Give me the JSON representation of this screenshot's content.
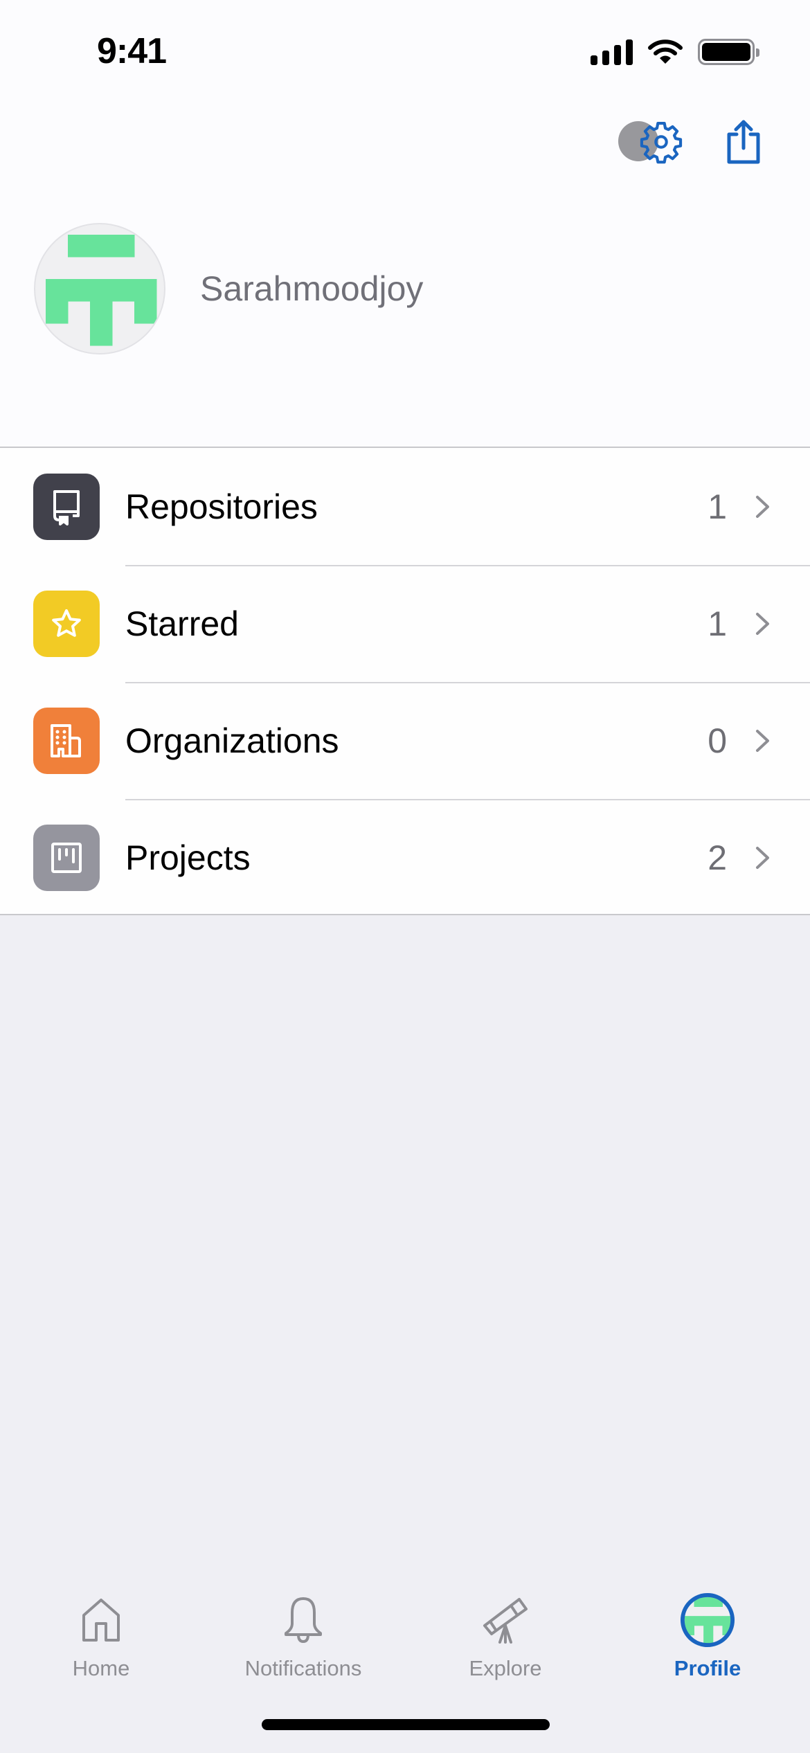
{
  "status_bar": {
    "time": "9:41",
    "icons": [
      "cellular-signal-icon",
      "wifi-icon",
      "battery-icon"
    ]
  },
  "header": {
    "actions": [
      {
        "name": "settings",
        "icon": "gear-icon"
      },
      {
        "name": "share",
        "icon": "share-icon"
      }
    ],
    "accent_color": "#1a65c0"
  },
  "profile": {
    "username": "Sarahmoodjoy",
    "avatar": {
      "type": "identicon",
      "color": "#67e39b",
      "background": "#f0f0f2",
      "grid": [
        [
          0,
          1,
          1,
          1,
          0
        ],
        [
          0,
          0,
          0,
          0,
          0
        ],
        [
          1,
          1,
          1,
          1,
          1
        ],
        [
          1,
          0,
          1,
          0,
          1
        ],
        [
          0,
          0,
          1,
          0,
          0
        ]
      ]
    }
  },
  "menu": {
    "items": [
      {
        "label": "Repositories",
        "count": "1",
        "icon": "repo-icon",
        "color": "#41414b"
      },
      {
        "label": "Starred",
        "count": "1",
        "icon": "star-icon",
        "color": "#f2cb25"
      },
      {
        "label": "Organizations",
        "count": "0",
        "icon": "organization-icon",
        "color": "#f0803a"
      },
      {
        "label": "Projects",
        "count": "2",
        "icon": "project-icon",
        "color": "#95959e"
      }
    ]
  },
  "tabbar": {
    "tabs": [
      {
        "label": "Home",
        "icon": "home-icon",
        "active": false
      },
      {
        "label": "Notifications",
        "icon": "bell-icon",
        "active": false
      },
      {
        "label": "Explore",
        "icon": "telescope-icon",
        "active": false
      },
      {
        "label": "Profile",
        "icon": "avatar-icon",
        "active": true
      }
    ]
  }
}
